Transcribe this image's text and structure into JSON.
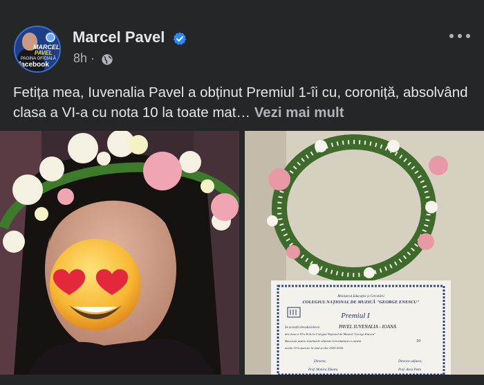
{
  "post": {
    "author": "Marcel Pavel",
    "time": "8h",
    "separator": "·",
    "text": "Fetița mea, Iuvenalia Pavel a obținut Premiul 1-îi cu, coroniță, absolvând clasa a VI-a cu nota 10 la toate mat… ",
    "see_more": "Vezi mai mult"
  },
  "avatar": {
    "name_line1": "MARCEL",
    "name_line2": "PAVEL",
    "caption": "PAGINA OFICIALĂ",
    "platform": "facebook"
  },
  "icons": {
    "verified": "verified-badge-icon",
    "audience": "globe-icon",
    "more": "more-options-icon"
  },
  "colors": {
    "background": "#252627",
    "verified": "#2d88ff",
    "text_primary": "#e4e6eb",
    "text_secondary": "#b0b3b8"
  },
  "photos": {
    "left": "portrait-with-flower-crown",
    "right": "flower-crown-and-diploma"
  },
  "diploma": {
    "ministry": "Ministerul Educației și Cercetării",
    "school": "COLEGIUL NAȚIONAL DE MUZICĂ \"GEORGE ENESCU\"",
    "award": "Premiul I",
    "grant_prefix": "Se acordă elevului/elevei",
    "student": "PAVEL IUVENALIA - IOANA",
    "class_line": "din clasa a VI-a B de la Colegiul Național de Muzică \"George Enescu\"",
    "city_line": "București pentru rezultatele obținute la învățătură cu media",
    "average": "10",
    "final_line": "media 10 la purtare în anul școlar 2025-2026.",
    "director_label": "Director,",
    "director_name": "Prof. Monica Zimaru",
    "deputy_label": "Director adjunct,",
    "deputy_name": "Prof. Anca Petre"
  }
}
